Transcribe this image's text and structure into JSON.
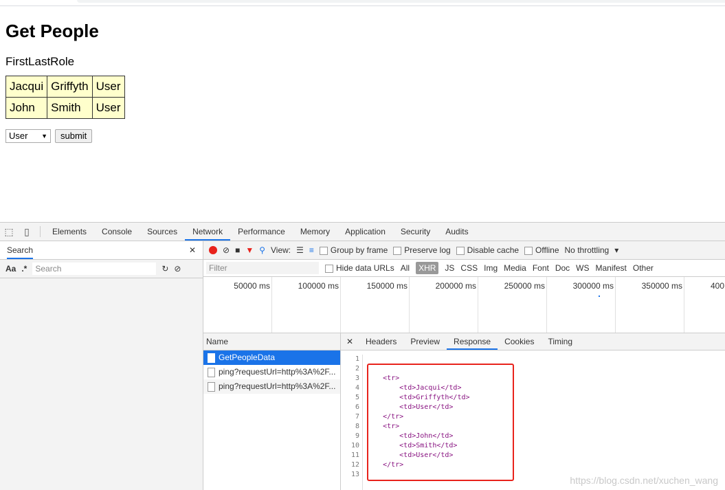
{
  "page": {
    "title": "Get People",
    "headers": "FirstLastRole",
    "rows": [
      [
        "Jacqui",
        "Griffyth",
        "User"
      ],
      [
        "John",
        "Smith",
        "User"
      ]
    ],
    "select_value": "User",
    "submit_label": "submit"
  },
  "devtools": {
    "tabs": [
      "Elements",
      "Console",
      "Sources",
      "Network",
      "Performance",
      "Memory",
      "Application",
      "Security",
      "Audits"
    ],
    "active_tab": "Network",
    "search_panel": {
      "label": "Search",
      "placeholder": "Search",
      "match_case": "Aa",
      "regex": ".*"
    },
    "toolbar": {
      "view_label": "View:",
      "group_by_frame": "Group by frame",
      "preserve_log": "Preserve log",
      "disable_cache": "Disable cache",
      "offline": "Offline",
      "throttling": "No throttling"
    },
    "filter": {
      "placeholder": "Filter",
      "hide_data_urls": "Hide data URLs",
      "types": [
        "All",
        "XHR",
        "JS",
        "CSS",
        "Img",
        "Media",
        "Font",
        "Doc",
        "WS",
        "Manifest",
        "Other"
      ],
      "active_type": "XHR"
    },
    "timeline_ticks": [
      "50000 ms",
      "100000 ms",
      "150000 ms",
      "200000 ms",
      "250000 ms",
      "300000 ms",
      "350000 ms",
      "400"
    ],
    "requests": {
      "header": "Name",
      "items": [
        "GetPeopleData",
        "ping?requestUrl=http%3A%2F...",
        "ping?requestUrl=http%3A%2F..."
      ]
    },
    "detail_tabs": [
      "Headers",
      "Preview",
      "Response",
      "Cookies",
      "Timing"
    ],
    "active_detail_tab": "Response",
    "line_numbers": [
      "1",
      "2",
      "3",
      "4",
      "5",
      "6",
      "7",
      "8",
      "9",
      "10",
      "11",
      "12",
      "13"
    ],
    "response_lines": [
      "",
      "",
      "    <tr>",
      "        <td>Jacqui</td>",
      "        <td>Griffyth</td>",
      "        <td>User</td>",
      "    </tr>",
      "    <tr>",
      "        <td>John</td>",
      "        <td>Smith</td>",
      "        <td>User</td>",
      "    </tr>",
      ""
    ]
  },
  "watermark": "https://blog.csdn.net/xuchen_wang",
  "colors": {
    "record": "#e8221b",
    "highlight_box": "#e8221b",
    "selected_row": "#1a73e8",
    "cell_bg": "#ffffcc"
  }
}
